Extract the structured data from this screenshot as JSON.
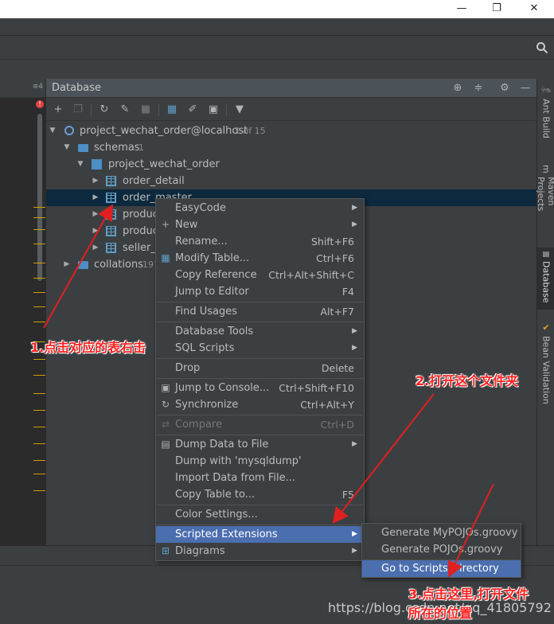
{
  "window": {
    "minimize_glyph": "—",
    "restore_glyph": "❐",
    "close_glyph": "✕"
  },
  "editor": {
    "tab_marker": "≡4"
  },
  "panel": {
    "title": "Database"
  },
  "tree": {
    "datasource": {
      "label": "project_wechat_order@localhost",
      "count": "1 of 15"
    },
    "schemas": {
      "label": "schemas",
      "count": "1"
    },
    "schema": {
      "label": "project_wechat_order"
    },
    "tables": [
      {
        "label": "order_detail"
      },
      {
        "label": "order_master"
      },
      {
        "label": "produc"
      },
      {
        "label": "produc"
      },
      {
        "label": "seller_in"
      }
    ],
    "collations": {
      "label": "collations",
      "count": "197"
    }
  },
  "context_menu": {
    "items": [
      {
        "label": "EasyCode",
        "shortcut": "",
        "submenu": true
      },
      {
        "label": "New",
        "shortcut": "",
        "submenu": true,
        "icon": "+"
      },
      {
        "label": "Rename...",
        "shortcut": "Shift+F6"
      },
      {
        "label": "Modify Table...",
        "shortcut": "Ctrl+F6"
      },
      {
        "label": "Copy Reference",
        "shortcut": "Ctrl+Alt+Shift+C"
      },
      {
        "label": "Jump to Editor",
        "shortcut": "F4"
      },
      {
        "label": "Find Usages",
        "shortcut": "Alt+F7"
      },
      {
        "label": "Database Tools",
        "shortcut": "",
        "submenu": true
      },
      {
        "label": "SQL Scripts",
        "shortcut": "",
        "submenu": true
      },
      {
        "label": "Drop",
        "shortcut": "Delete"
      },
      {
        "label": "Jump to Console...",
        "shortcut": "Ctrl+Shift+F10"
      },
      {
        "label": "Synchronize",
        "shortcut": "Ctrl+Alt+Y"
      },
      {
        "label": "Compare",
        "shortcut": "Ctrl+D",
        "disabled": true
      },
      {
        "label": "Dump Data to File",
        "shortcut": "",
        "submenu": true
      },
      {
        "label": "Dump with 'mysqldump'",
        "shortcut": ""
      },
      {
        "label": "Import Data from File...",
        "shortcut": ""
      },
      {
        "label": "Copy Table to...",
        "shortcut": "F5"
      },
      {
        "label": "Color Settings...",
        "shortcut": ""
      },
      {
        "label": "Scripted Extensions",
        "shortcut": "",
        "submenu": true,
        "highlighted": true
      },
      {
        "label": "Diagrams",
        "shortcut": "",
        "submenu": true
      }
    ]
  },
  "submenu": {
    "items": [
      {
        "label": "Generate MyPOJOs.groovy"
      },
      {
        "label": "Generate POJOs.groovy"
      },
      {
        "label": "Go to Scripts Directory",
        "highlighted": true
      }
    ]
  },
  "right_tabs": [
    {
      "label": "Ant Build",
      "icon": "🐜"
    },
    {
      "label": "Maven Projects",
      "icon": "m"
    },
    {
      "label": "Database",
      "icon": "≣",
      "active": true
    },
    {
      "label": "Bean Validation",
      "icon": "✔"
    }
  ],
  "annotations": {
    "step1": "1.点击对应的表右击",
    "step2": "2.打开这个文件夹",
    "step3_line1": "3.点击这里,打开文件",
    "step3_line2": "所在的位置"
  },
  "watermark": "https://blog.csdn.net/qq_41805792",
  "colors": {
    "background": "#3c3f41",
    "selection": "#0d293e",
    "highlight": "#4b6eaf",
    "annotation": "#ff2020"
  }
}
